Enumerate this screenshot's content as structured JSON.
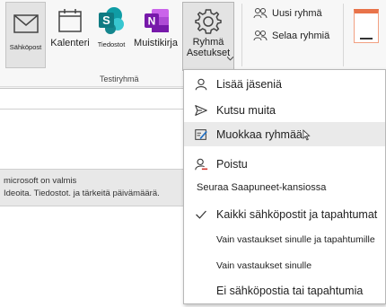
{
  "ribbon": {
    "email_label": "Sähköpost",
    "calendar_label": "Kalenteri",
    "files_label": "Tiedostot",
    "notebook_label": "Muistikirja",
    "settings_label_line1": "Ryhmä",
    "settings_label_line2": "Asetukset",
    "group_label": "Testiryhmä",
    "new_group_label": "Uusi ryhmä",
    "browse_groups_label": "Selaa ryhmiä"
  },
  "content": {
    "line1": "microsoft on valmis",
    "line2": "Ideoita. Tiedostot. ja tärkeitä päivämäärä."
  },
  "menu": {
    "add_members": "Lisää jäseniä",
    "invite_others": "Kutsu muita",
    "edit_group": "Muokkaa ryhmää",
    "leave": "Poistu",
    "follow_heading": "Seuraa Saapuneet-kansiossa",
    "all_email_events": "Kaikki sähköpostit ja tapahtumat",
    "replies_and_events": "Vain vastaukset sinulle ja tapahtumille",
    "replies_only": "Vain vastaukset sinulle",
    "no_email_events": "Ei sähköpostia tai tapahtumia"
  },
  "colors": {
    "sharepoint_teal": "#0f7b83",
    "onenote_purple": "#7719aa",
    "leave_red": "#d0342c",
    "office_orange": "#e8734a"
  }
}
